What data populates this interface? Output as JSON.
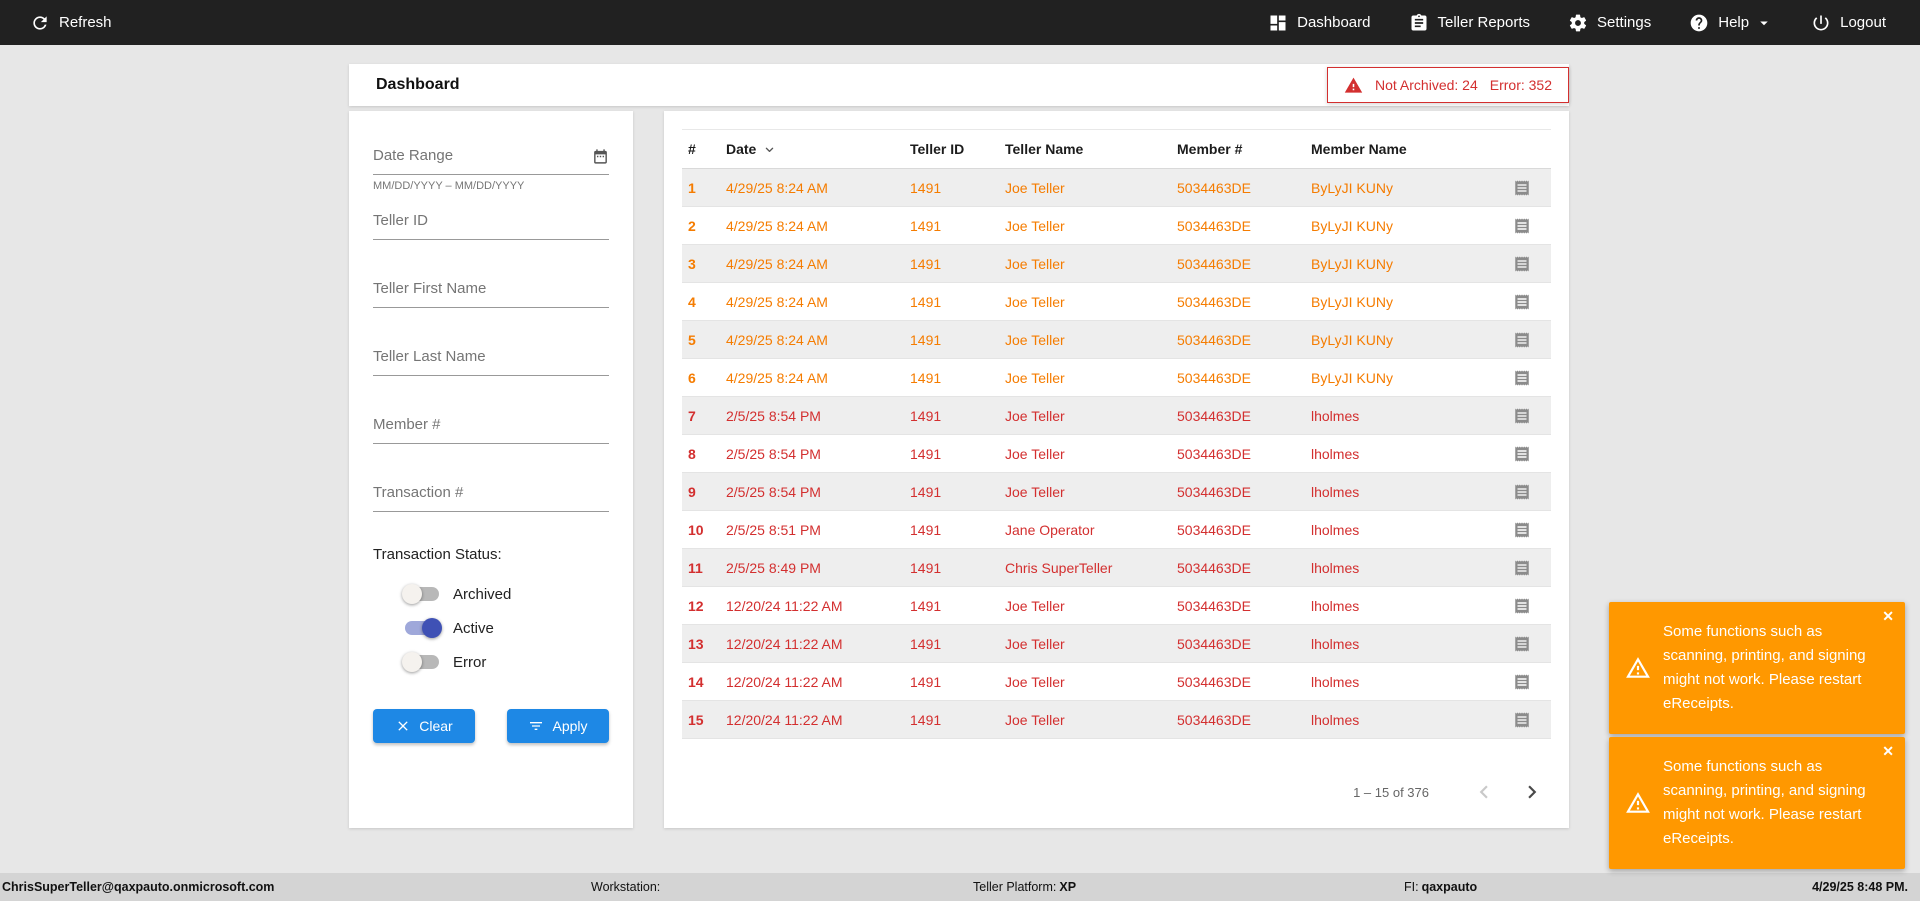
{
  "colors": {
    "topbar": "#212121",
    "orange": "#f57c00",
    "red": "#d32f2f",
    "blue": "#1e88e5",
    "toast": "#ff9800",
    "toggle_on": "#3f51b5",
    "toggle_on_track": "#9fa8da"
  },
  "topbar": {
    "refresh": "Refresh",
    "nav": {
      "dashboard": "Dashboard",
      "teller_reports": "Teller Reports",
      "settings": "Settings",
      "help": "Help",
      "logout": "Logout"
    }
  },
  "page": {
    "title": "Dashboard",
    "badge": {
      "not_archived": "Not Archived: 24",
      "error": "Error: 352"
    }
  },
  "filters": {
    "date_range": {
      "placeholder": "Date Range",
      "hint": "MM/DD/YYYY – MM/DD/YYYY"
    },
    "teller_id": {
      "placeholder": "Teller ID"
    },
    "teller_first_name": {
      "placeholder": "Teller First Name"
    },
    "teller_last_name": {
      "placeholder": "Teller Last Name"
    },
    "member_number": {
      "placeholder": "Member #"
    },
    "transaction_number": {
      "placeholder": "Transaction #"
    },
    "status_label": "Transaction Status:",
    "toggles": [
      {
        "label": "Archived",
        "on": false
      },
      {
        "label": "Active",
        "on": true
      },
      {
        "label": "Error",
        "on": false
      }
    ],
    "clear_label": "Clear",
    "apply_label": "Apply"
  },
  "table": {
    "columns": [
      "#",
      "Date",
      "Teller ID",
      "Teller Name",
      "Member #",
      "Member Name"
    ],
    "sort": {
      "column": "Date",
      "direction": "desc"
    },
    "rows": [
      {
        "num": "1",
        "date": "4/29/25 8:24 AM",
        "teller_id": "1491",
        "teller_name": "Joe Teller",
        "member_number": "5034463DE",
        "member_name": "ByLyJI KUNy",
        "status": "warning"
      },
      {
        "num": "2",
        "date": "4/29/25 8:24 AM",
        "teller_id": "1491",
        "teller_name": "Joe Teller",
        "member_number": "5034463DE",
        "member_name": "ByLyJI KUNy",
        "status": "warning"
      },
      {
        "num": "3",
        "date": "4/29/25 8:24 AM",
        "teller_id": "1491",
        "teller_name": "Joe Teller",
        "member_number": "5034463DE",
        "member_name": "ByLyJI KUNy",
        "status": "warning"
      },
      {
        "num": "4",
        "date": "4/29/25 8:24 AM",
        "teller_id": "1491",
        "teller_name": "Joe Teller",
        "member_number": "5034463DE",
        "member_name": "ByLyJI KUNy",
        "status": "warning"
      },
      {
        "num": "5",
        "date": "4/29/25 8:24 AM",
        "teller_id": "1491",
        "teller_name": "Joe Teller",
        "member_number": "5034463DE",
        "member_name": "ByLyJI KUNy",
        "status": "warning"
      },
      {
        "num": "6",
        "date": "4/29/25 8:24 AM",
        "teller_id": "1491",
        "teller_name": "Joe Teller",
        "member_number": "5034463DE",
        "member_name": "ByLyJI KUNy",
        "status": "warning"
      },
      {
        "num": "7",
        "date": "2/5/25 8:54 PM",
        "teller_id": "1491",
        "teller_name": "Joe Teller",
        "member_number": "5034463DE",
        "member_name": "lholmes",
        "status": "error"
      },
      {
        "num": "8",
        "date": "2/5/25 8:54 PM",
        "teller_id": "1491",
        "teller_name": "Joe Teller",
        "member_number": "5034463DE",
        "member_name": "lholmes",
        "status": "error"
      },
      {
        "num": "9",
        "date": "2/5/25 8:54 PM",
        "teller_id": "1491",
        "teller_name": "Joe Teller",
        "member_number": "5034463DE",
        "member_name": "lholmes",
        "status": "error"
      },
      {
        "num": "10",
        "date": "2/5/25 8:51 PM",
        "teller_id": "1491",
        "teller_name": "Jane Operator",
        "member_number": "5034463DE",
        "member_name": "lholmes",
        "status": "error"
      },
      {
        "num": "11",
        "date": "2/5/25 8:49 PM",
        "teller_id": "1491",
        "teller_name": "Chris SuperTeller",
        "member_number": "5034463DE",
        "member_name": "lholmes",
        "status": "error"
      },
      {
        "num": "12",
        "date": "12/20/24 11:22 AM",
        "teller_id": "1491",
        "teller_name": "Joe Teller",
        "member_number": "5034463DE",
        "member_name": "lholmes",
        "status": "error"
      },
      {
        "num": "13",
        "date": "12/20/24 11:22 AM",
        "teller_id": "1491",
        "teller_name": "Joe Teller",
        "member_number": "5034463DE",
        "member_name": "lholmes",
        "status": "error"
      },
      {
        "num": "14",
        "date": "12/20/24 11:22 AM",
        "teller_id": "1491",
        "teller_name": "Joe Teller",
        "member_number": "5034463DE",
        "member_name": "lholmes",
        "status": "error"
      },
      {
        "num": "15",
        "date": "12/20/24 11:22 AM",
        "teller_id": "1491",
        "teller_name": "Joe Teller",
        "member_number": "5034463DE",
        "member_name": "lholmes",
        "status": "error"
      }
    ],
    "pagination": {
      "range": "1 – 15 of 376"
    }
  },
  "toasts": [
    {
      "message": "Some functions such as scanning, printing, and signing might not work. Please restart eReceipts."
    },
    {
      "message": "Some functions such as scanning, printing, and signing might not work. Please restart eReceipts."
    }
  ],
  "footer": {
    "user": "ChrisSuperTeller@qaxpauto.onmicrosoft.com",
    "workstation_label": "Workstation:",
    "teller_platform_label": "Teller Platform:",
    "teller_platform_value": "XP",
    "fi_label": "FI:",
    "fi_value": "qaxpauto",
    "datetime": "4/29/25 8:48 PM."
  }
}
